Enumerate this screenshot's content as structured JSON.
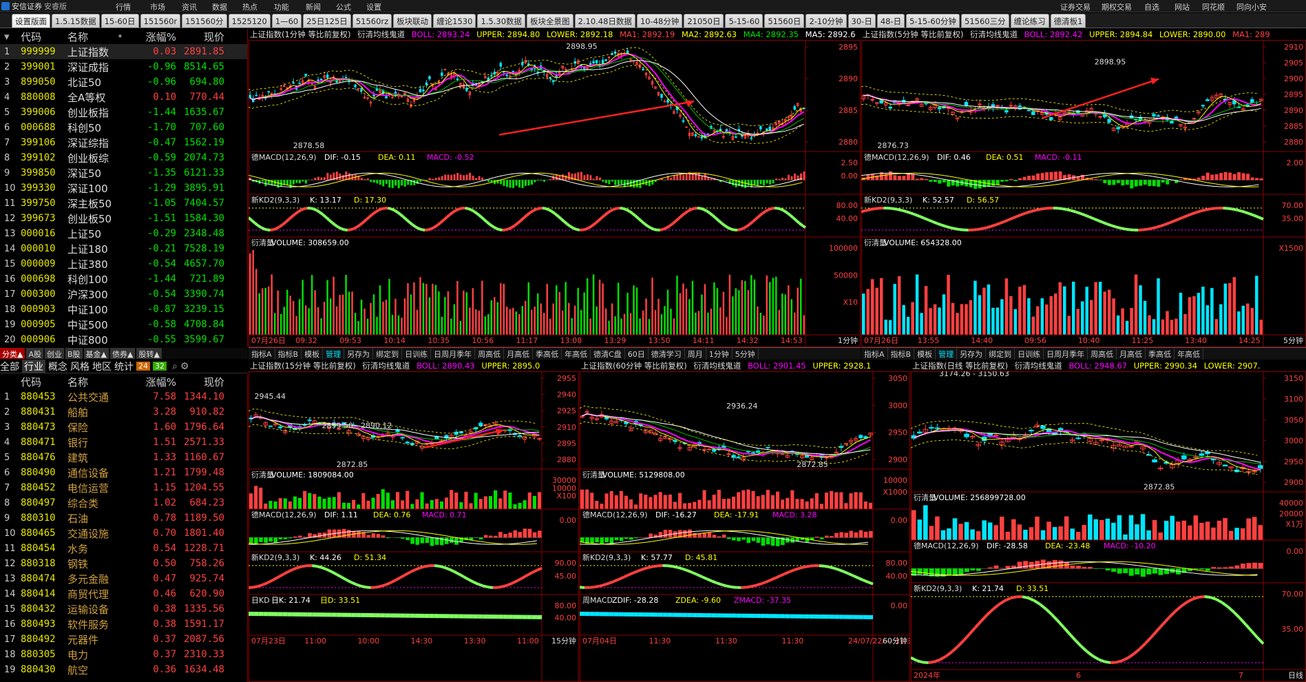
{
  "app": {
    "brand": "安信证券",
    "brand_sub": "安睿版",
    "menu": [
      "行情",
      "市场",
      "资讯",
      "数据",
      "热点",
      "功能",
      "新闻",
      "公式",
      "设置"
    ],
    "right_menu": [
      "证券交易",
      "期权交易",
      "自选",
      "网站",
      "同花顺",
      "同向小安"
    ]
  },
  "tabs": [
    "设置版面",
    "1.5.15数据",
    "15-60日",
    "151560r",
    "151560分",
    "1525120",
    "1—60",
    "25日125日",
    "51560rz",
    "板块联动",
    "缠论1530",
    "1.5.30数据",
    "板块全景图",
    "2.10.48日数据",
    "10-48分钟",
    "21050日",
    "5-15-60",
    "51560日",
    "2-10分钟",
    "30-日",
    "48-日",
    "5-15-60分钟",
    "51560三分",
    "缠论练习",
    "德清板1"
  ],
  "top_list": {
    "headers": {
      "code": "代码",
      "name": "名称",
      "dot": "•",
      "pct": "涨幅%",
      "price": "现价"
    },
    "rows": [
      {
        "n": "1",
        "code": "999999",
        "name": "上证指数",
        "pct": "0.03",
        "price": "2891.85",
        "dir": "up"
      },
      {
        "n": "2",
        "code": "399001",
        "name": "深证成指",
        "pct": "-0.96",
        "price": "8514.65",
        "dir": "dn"
      },
      {
        "n": "3",
        "code": "899050",
        "name": "北证50",
        "pct": "-0.96",
        "price": "694.80",
        "dir": "dn"
      },
      {
        "n": "4",
        "code": "880008",
        "name": "全A等权",
        "pct": "0.10",
        "price": "770.44",
        "dir": "up"
      },
      {
        "n": "5",
        "code": "399006",
        "name": "创业板指",
        "pct": "-1.44",
        "price": "1635.67",
        "dir": "dn"
      },
      {
        "n": "6",
        "code": "000688",
        "name": "科创50",
        "pct": "-1.70",
        "price": "707.60",
        "dir": "dn"
      },
      {
        "n": "7",
        "code": "399106",
        "name": "深证综指",
        "pct": "-0.47",
        "price": "1562.19",
        "dir": "dn"
      },
      {
        "n": "8",
        "code": "399102",
        "name": "创业板综",
        "pct": "-0.59",
        "price": "2074.73",
        "dir": "dn"
      },
      {
        "n": "9",
        "code": "399850",
        "name": "深证50",
        "pct": "-1.35",
        "price": "6121.33",
        "dir": "dn"
      },
      {
        "n": "10",
        "code": "399330",
        "name": "深证100",
        "pct": "-1.29",
        "price": "3895.91",
        "dir": "dn"
      },
      {
        "n": "11",
        "code": "399750",
        "name": "深主板50",
        "pct": "-1.05",
        "price": "7404.57",
        "dir": "dn"
      },
      {
        "n": "12",
        "code": "399673",
        "name": "创业板50",
        "pct": "-1.51",
        "price": "1584.30",
        "dir": "dn"
      },
      {
        "n": "13",
        "code": "000016",
        "name": "上证50",
        "pct": "-0.29",
        "price": "2348.48",
        "dir": "dn"
      },
      {
        "n": "14",
        "code": "000010",
        "name": "上证180",
        "pct": "-0.21",
        "price": "7528.19",
        "dir": "dn"
      },
      {
        "n": "15",
        "code": "000009",
        "name": "上证380",
        "pct": "-0.54",
        "price": "4657.70",
        "dir": "dn"
      },
      {
        "n": "16",
        "code": "000698",
        "name": "科创100",
        "pct": "-1.44",
        "price": "721.89",
        "dir": "dn"
      },
      {
        "n": "17",
        "code": "000300",
        "name": "沪深300",
        "pct": "-0.54",
        "price": "3390.74",
        "dir": "dn"
      },
      {
        "n": "18",
        "code": "000903",
        "name": "中证100",
        "pct": "-0.87",
        "price": "3239.15",
        "dir": "dn"
      },
      {
        "n": "19",
        "code": "000905",
        "name": "中证500",
        "pct": "-0.58",
        "price": "4708.84",
        "dir": "dn"
      },
      {
        "n": "20",
        "code": "000906",
        "name": "中证800",
        "pct": "-0.55",
        "price": "3599.67",
        "dir": "dn"
      }
    ]
  },
  "mid_tabs": [
    "分类▲",
    "A股",
    "创业",
    "B股",
    "基金▲",
    "债券▲",
    "股转▲"
  ],
  "filter_tabs": [
    "全部",
    "行业",
    "概念",
    "风格",
    "地区",
    "统计"
  ],
  "filter_badges": [
    "24",
    "32"
  ],
  "sector_list": {
    "headers": {
      "code": "代码",
      "name": "名称",
      "pct": "涨幅%",
      "price": "现价"
    },
    "rows": [
      {
        "n": "1",
        "code": "880453",
        "name": "公共交通",
        "pct": "7.58",
        "price": "1344.10"
      },
      {
        "n": "2",
        "code": "880431",
        "name": "船舶",
        "pct": "3.28",
        "price": "910.82"
      },
      {
        "n": "3",
        "code": "880473",
        "name": "保险",
        "pct": "1.60",
        "price": "1796.64"
      },
      {
        "n": "4",
        "code": "880471",
        "name": "银行",
        "pct": "1.51",
        "price": "2571.33"
      },
      {
        "n": "5",
        "code": "880476",
        "name": "建筑",
        "pct": "1.33",
        "price": "1160.67"
      },
      {
        "n": "6",
        "code": "880490",
        "name": "通信设备",
        "pct": "1.21",
        "price": "1799.48"
      },
      {
        "n": "7",
        "code": "880452",
        "name": "电信运营",
        "pct": "1.15",
        "price": "1204.55"
      },
      {
        "n": "8",
        "code": "880497",
        "name": "综合类",
        "pct": "1.02",
        "price": "684.23"
      },
      {
        "n": "9",
        "code": "880310",
        "name": "石油",
        "pct": "0.78",
        "price": "1189.50"
      },
      {
        "n": "10",
        "code": "880465",
        "name": "交通设施",
        "pct": "0.70",
        "price": "1801.40"
      },
      {
        "n": "11",
        "code": "880454",
        "name": "水务",
        "pct": "0.54",
        "price": "1228.71"
      },
      {
        "n": "12",
        "code": "880318",
        "name": "钢铁",
        "pct": "0.50",
        "price": "758.26"
      },
      {
        "n": "13",
        "code": "880474",
        "name": "多元金融",
        "pct": "0.47",
        "price": "925.74"
      },
      {
        "n": "14",
        "code": "880414",
        "name": "商贸代理",
        "pct": "0.46",
        "price": "620.90"
      },
      {
        "n": "15",
        "code": "880432",
        "name": "运输设备",
        "pct": "0.38",
        "price": "1335.56"
      },
      {
        "n": "16",
        "code": "880493",
        "name": "软件服务",
        "pct": "0.38",
        "price": "1591.17"
      },
      {
        "n": "17",
        "code": "880492",
        "name": "元器件",
        "pct": "0.37",
        "price": "2087.56"
      },
      {
        "n": "18",
        "code": "880305",
        "name": "电力",
        "pct": "0.37",
        "price": "2310.33"
      },
      {
        "n": "19",
        "code": "880430",
        "name": "航空",
        "pct": "0.36",
        "price": "1634.48"
      }
    ]
  },
  "chart1": {
    "title": "上证指数(1分钟 等比前复权)",
    "ind": "衍清均线鬼道",
    "boll": "BOLL: 2893.24",
    "upper": "UPPER: 2894.80",
    "lower": "LOWER: 2892.18",
    "ma1": "MA1: 2892.19",
    "ma2": "MA2: 2892.63",
    "ma4": "MA4: 2892.35",
    "ma5": "MA5: 2892.6",
    "yticks": [
      "2895",
      "2890",
      "2885",
      "2880"
    ],
    "hi": "2898.95",
    "lo": "2878.58",
    "macd_title": "德MACD(12,26,9)",
    "dif": "DIF: -0.15",
    "dea": "DEA: 0.11",
    "macd": "MACD: -0.52",
    "macd_ticks": [
      "2.50",
      "0.00"
    ],
    "kd_title": "新KD2(9,3,3)",
    "k": "K: 13.17",
    "d": "D: 17.30",
    "kd_ticks": [
      "80.00",
      "40.00"
    ],
    "vol_title": "衍清量",
    "vol": "VOLUME: 308659.00",
    "vol_ticks": [
      "100000",
      "50000",
      "X10"
    ],
    "times": [
      "07月26日",
      "09:32",
      "09:53",
      "10:14",
      "10:35",
      "10:56",
      "11:17",
      "13:08",
      "13:29",
      "13:50",
      "14:11",
      "14:32",
      "14:53"
    ],
    "period": "1分钟"
  },
  "chart2": {
    "title": "上证指数(5分钟 等比前复权)",
    "ind": "衍清均线鬼道",
    "boll": "BOLL: 2892.42",
    "upper": "UPPER: 2894.84",
    "lower": "LOWER: 2890.00",
    "ma1": "MA1: 289",
    "yticks": [
      "2910",
      "2905",
      "2900",
      "2895",
      "2890",
      "2885",
      "2880"
    ],
    "hi": "2898.95",
    "lo": "2876.73",
    "macd_title": "德MACD(12,26,9)",
    "dif": "DIF: 0.46",
    "dea": "DEA: 0.51",
    "macd": "MACD: -0.11",
    "macd_ticks": [
      "2.00"
    ],
    "kd_title": "新KD2(9,3,3)",
    "k": "K: 52.57",
    "d": "D: 56.57",
    "kd_ticks": [
      "70.00",
      "35.00"
    ],
    "vol_title": "衍清量",
    "vol": "VOLUME: 654328.00",
    "vol_ticks": [
      "X1500"
    ],
    "times": [
      "07月26日",
      "13:55",
      "14:40",
      "09:56",
      "10:40",
      "11:25",
      "13:40",
      "14:25"
    ],
    "period": "5分钟"
  },
  "chart3": {
    "title": "上证指数(15分钟 等比前复权)",
    "ind": "衍清均线鬼道",
    "boll": "BOLL: 2890.43",
    "upper": "UPPER: 2895.0",
    "yticks": [
      "2955",
      "2940",
      "2925",
      "2910",
      "2895",
      "2880"
    ],
    "hi": "2945.44",
    "mid": "2899.50 - 2890.12",
    "lo": "2872.85",
    "vol_title": "衍清量",
    "vol": "VOLUME: 1809084.00",
    "vol_ticks": [
      "30000",
      "10000",
      "X100"
    ],
    "macd_title": "德MACD(12,26,9)",
    "dif": "DIF: 1.11",
    "dea": "DEA: 0.76",
    "macd": "MACD: 0.71",
    "macd_ticks": [
      "0.00"
    ],
    "kd_title": "新KD2(9,3,3)",
    "k": "K: 44.26",
    "d": "D: 51.34",
    "kd_ticks": [
      "90.00",
      "45.00"
    ],
    "rkd_title": "日KD",
    "rk": "日K: 21.74",
    "rd": "日D: 33.51",
    "rkd_ticks": [
      "80.00",
      "40.00"
    ],
    "times": [
      "07月23日",
      "11:00",
      "10:00",
      "14:30",
      "13:30",
      "11:00"
    ],
    "period": "15分钟"
  },
  "chart4": {
    "title": "上证指数(60分钟 等比前复权)",
    "ind": "衍清均线鬼道",
    "boll": "BOLL: 2901.45",
    "upper": "UPPER: 2928.1",
    "yticks": [
      "3050",
      "3000",
      "2950",
      "2900"
    ],
    "hi": "2936.24",
    "lo": "2872.85",
    "vol_title": "衍清量",
    "vol": "VOLUME: 5129808.00",
    "vol_ticks": [
      "10000",
      "X1000"
    ],
    "macd_title": "德MACD(12,26,9)",
    "dif": "DIF: -16.27",
    "dea": "DEA: -17.91",
    "macd": "MACD: 3.28",
    "macd_ticks": [
      "0.00"
    ],
    "kd_title": "新KD2(9,3,3)",
    "k": "K: 57.77",
    "d": "D: 45.81",
    "kd_ticks": [
      "80.00",
      "40.00"
    ],
    "wm_title": "周MACD",
    "zdif": "ZDIF: -28.28",
    "zdea": "ZDEA: -9.60",
    "zmacd": "ZMACD: -37.35",
    "wm_ticks": [
      "0.00"
    ],
    "times": [
      "07月04日",
      "11:30",
      "11:30",
      "11:30",
      "24/07/22/— 11:30"
    ],
    "period": "60分钟"
  },
  "chart5": {
    "title": "上证指数(日线 等比前复权)",
    "ind": "衍清均线鬼道",
    "boll": "BOLL: 2948.67",
    "upper": "UPPER: 2990.34",
    "lower": "LOWER: 2907.",
    "yticks": [
      "3150",
      "3100",
      "3050",
      "3000",
      "2950",
      "2900"
    ],
    "hi": "3174.26 - 3150.63",
    "lo": "2872.85",
    "vol_title": "衍清量",
    "vol": "VOLUME: 256899728.00",
    "vol_ticks": [
      "40000",
      "20000",
      "X1万"
    ],
    "macd_title": "德MACD(12,26,9)",
    "dif": "DIF: -28.58",
    "dea": "DEA: -23.48",
    "macd": "MACD: -10.20",
    "macd_ticks": [
      "0.00"
    ],
    "kd_title": "新KD2(9,3,3)",
    "k": "K: 21.74",
    "d": "D: 33.51",
    "kd_ticks": [
      "70.00",
      "35.00"
    ],
    "times": [
      "2024年",
      "6",
      "7"
    ],
    "period": "日线"
  },
  "bar1": [
    "指标A",
    "指标B",
    "模板",
    "管理",
    "另存为",
    "绑定到",
    "日训练",
    "日周月季年",
    "周高低",
    "月高低",
    "季高低",
    "年高低",
    "德清C盘",
    "60日",
    "德清学习",
    "周月",
    "1分钟",
    "5分钟"
  ],
  "bar2": [
    "指标A",
    "指标B",
    "模板",
    "管理",
    "另存为",
    "绑定到",
    "日训练",
    "日周月季年",
    "周高低",
    "月高低",
    "季高低",
    "年高低"
  ],
  "colors": {
    "up": "#ff4040",
    "down": "#00e000",
    "bg": "#000000",
    "grid": "#8b0000",
    "ma_magenta": "#ff00ff",
    "ma_yellow": "#ffff00",
    "ma_green": "#00c000",
    "ma_white": "#ffffff",
    "accent_cyan": "#00e5ff"
  }
}
